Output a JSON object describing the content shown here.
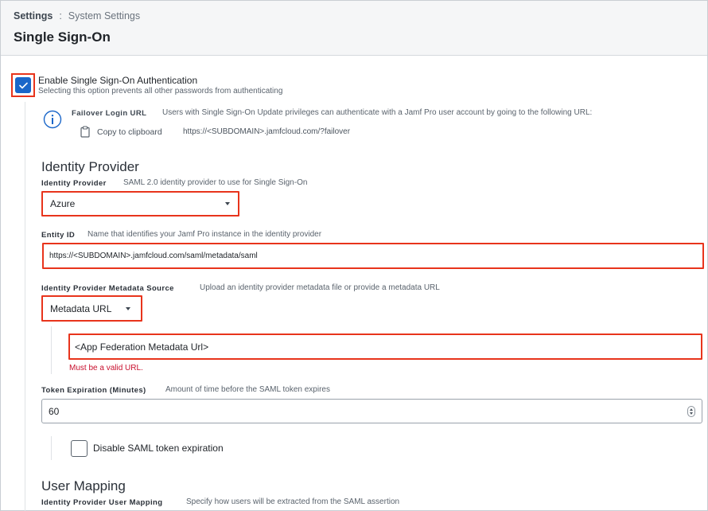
{
  "breadcrumb": {
    "root": "Settings",
    "separator": ":",
    "current": "System Settings"
  },
  "page_title": "Single Sign-On",
  "sso": {
    "label": "Enable Single Sign-On Authentication",
    "help": "Selecting this option prevents all other passwords from authenticating",
    "checked": true
  },
  "failover": {
    "label": "Failover Login URL",
    "description": "Users with Single Sign-On Update privileges can authenticate with a Jamf Pro user account by going to the following URL:",
    "copy_label": "Copy to clipboard",
    "url": "https://<SUBDOMAIN>.jamfcloud.com/?failover"
  },
  "identity_provider_section": {
    "title": "Identity Provider",
    "provider": {
      "label": "Identity Provider",
      "description": "SAML 2.0 identity provider to use for Single Sign-On",
      "value": "Azure"
    },
    "entity_id": {
      "label": "Entity ID",
      "description": "Name that identifies your Jamf Pro instance in the identity provider",
      "value": "https://<SUBDOMAIN>.jamfcloud.com/saml/metadata/saml"
    },
    "metadata_source": {
      "label": "Identity Provider Metadata Source",
      "description": "Upload an identity provider metadata file or provide a metadata URL",
      "value": "Metadata URL"
    },
    "metadata_url": {
      "value": "<App Federation Metadata Url>",
      "error": "Must be a valid URL."
    },
    "token_expiration": {
      "label": "Token Expiration (Minutes)",
      "description": "Amount of time before the SAML token expires",
      "value": "60"
    },
    "disable_expiration": {
      "label": "Disable SAML token expiration",
      "checked": false
    }
  },
  "user_mapping_section": {
    "title": "User Mapping",
    "label": "Identity Provider User Mapping",
    "description": "Specify how users will be extracted from the SAML assertion"
  },
  "colors": {
    "accent": "#1a66c9",
    "highlight": "#e8341c",
    "error": "#c8102e",
    "header_bg": "#f5f6f7"
  },
  "icons": {
    "checkbox_checked": "checkmark-icon",
    "info": "info-icon",
    "clipboard": "clipboard-icon",
    "dropdown": "caret-down-icon",
    "stepper": "stepper-icon"
  }
}
